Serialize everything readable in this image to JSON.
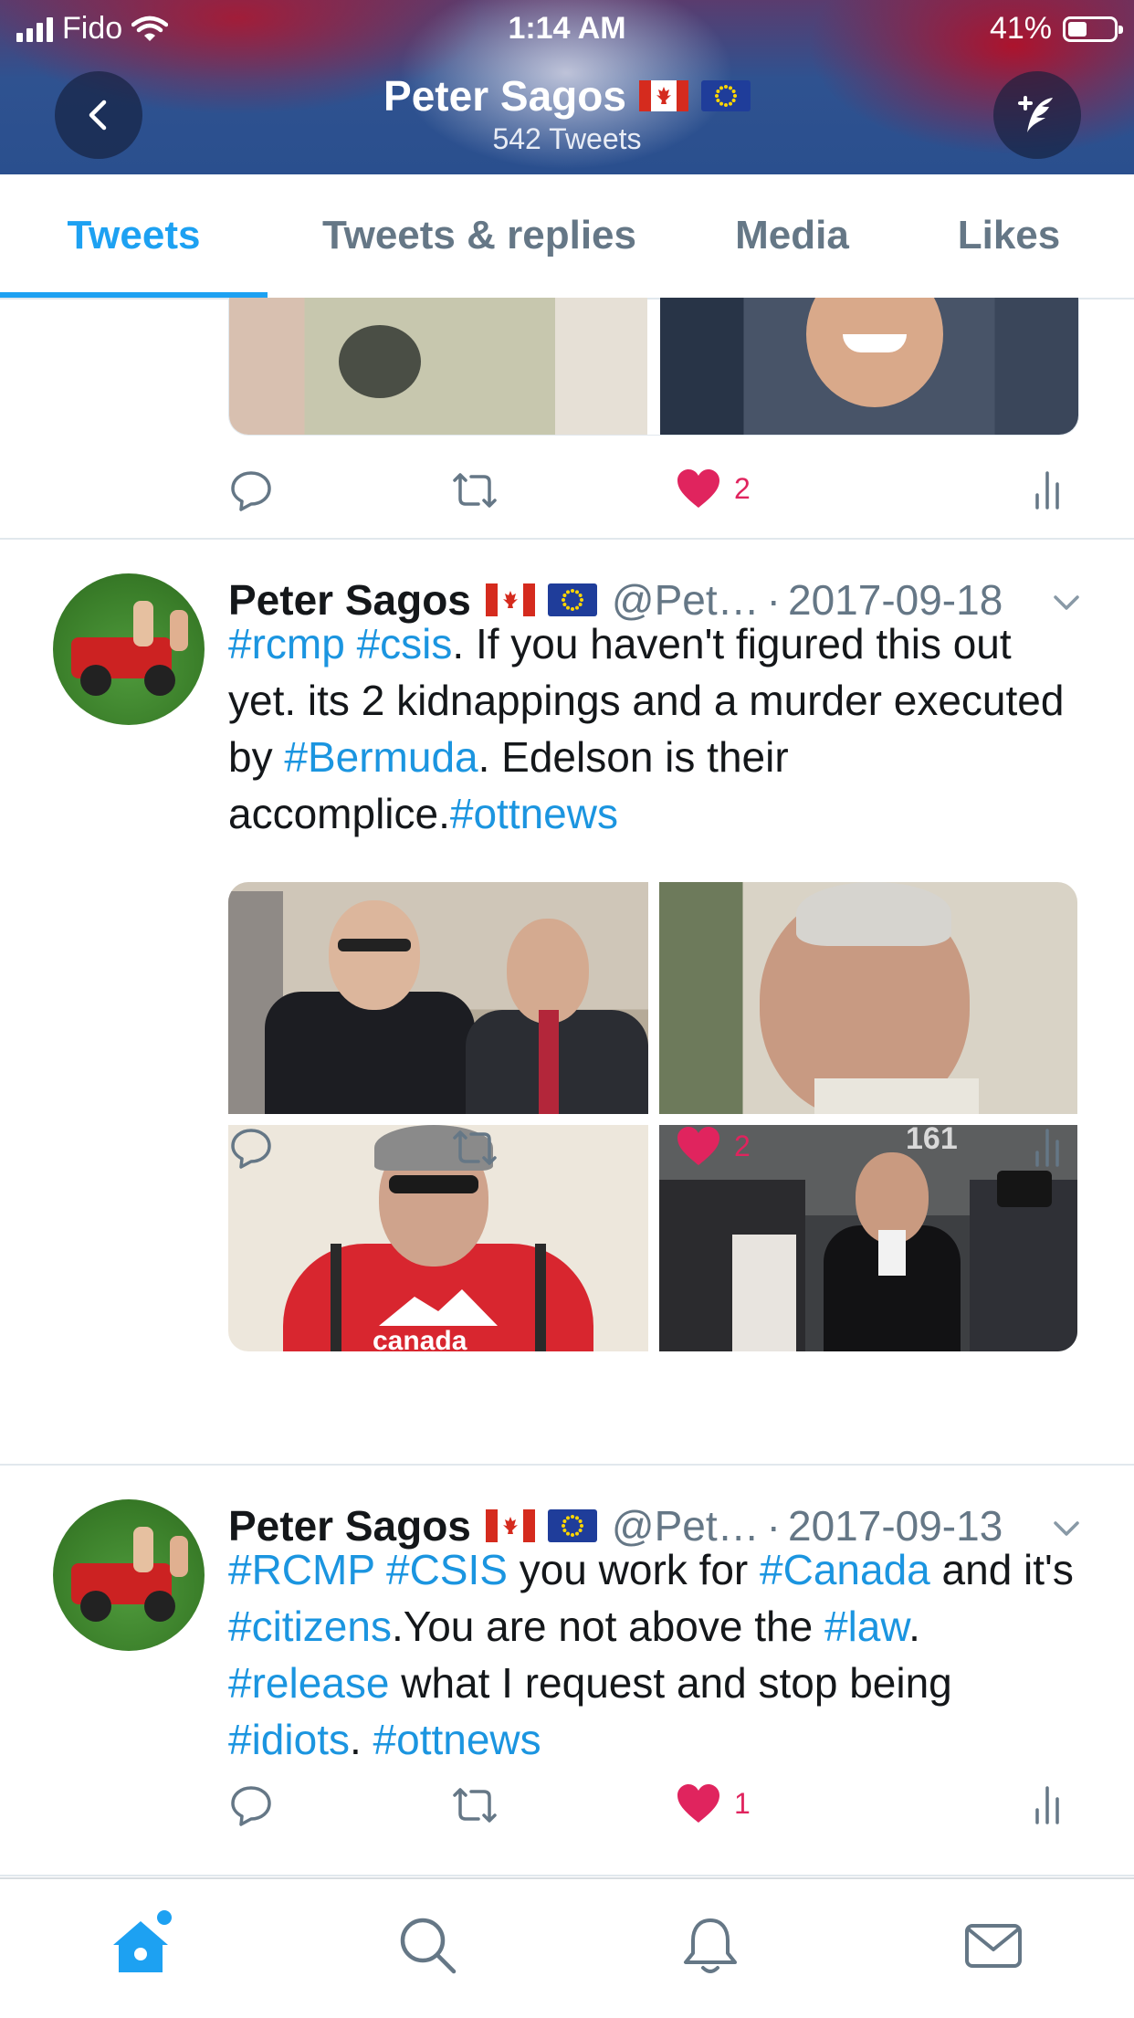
{
  "status_bar": {
    "carrier": "Fido",
    "time": "1:14 AM",
    "battery_percent": "41%",
    "battery_level": 0.41
  },
  "header": {
    "name": "Peter Sagos",
    "tweet_count": "542 Tweets"
  },
  "tabs": [
    {
      "label": "Tweets",
      "active": true
    },
    {
      "label": "Tweets & replies",
      "active": false
    },
    {
      "label": "Media",
      "active": false
    },
    {
      "label": "Likes",
      "active": false
    }
  ],
  "tweets": [
    {
      "like_count": "2"
    },
    {
      "name": "Peter Sagos",
      "handle": "@Pet…",
      "date": "2017-09-18",
      "text": [
        {
          "t": "#rcmp",
          "tag": true
        },
        {
          "t": " ",
          "tag": false
        },
        {
          "t": "#csis",
          "tag": true
        },
        {
          "t": ". If you haven't figured this out yet. its 2 kidnappings and a murder executed by ",
          "tag": false
        },
        {
          "t": "#Bermuda",
          "tag": true
        },
        {
          "t": ". Edelson is their accomplice.",
          "tag": false
        },
        {
          "t": "#ottnews",
          "tag": true
        }
      ],
      "photo_text": [
        "161",
        "canada"
      ],
      "like_count": "2"
    },
    {
      "name": "Peter Sagos",
      "handle": "@Pet…",
      "date": "2017-09-13",
      "text": [
        {
          "t": "#RCMP",
          "tag": true
        },
        {
          "t": " ",
          "tag": false
        },
        {
          "t": "#CSIS",
          "tag": true
        },
        {
          "t": " you work for ",
          "tag": false
        },
        {
          "t": "#Canada",
          "tag": true
        },
        {
          "t": " and it's ",
          "tag": false
        },
        {
          "t": "#citizens",
          "tag": true
        },
        {
          "t": ".You are not above the ",
          "tag": false
        },
        {
          "t": "#law",
          "tag": true
        },
        {
          "t": ". ",
          "tag": false
        },
        {
          "t": "#release",
          "tag": true
        },
        {
          "t": " what I request and stop being ",
          "tag": false
        },
        {
          "t": "#idiots",
          "tag": true
        },
        {
          "t": ". ",
          "tag": false
        },
        {
          "t": "#ottnews",
          "tag": true
        }
      ],
      "like_count": "1"
    }
  ],
  "colors": {
    "accent": "#1da1f2",
    "hashtag": "#1b95e0",
    "like": "#e0245e",
    "meta": "#657786"
  },
  "icons": [
    "back-arrow-icon",
    "compose-tweet-icon",
    "reply-icon",
    "retweet-icon",
    "heart-icon",
    "analytics-icon",
    "chevron-down-icon",
    "home-icon",
    "search-icon",
    "notifications-icon",
    "messages-icon"
  ]
}
